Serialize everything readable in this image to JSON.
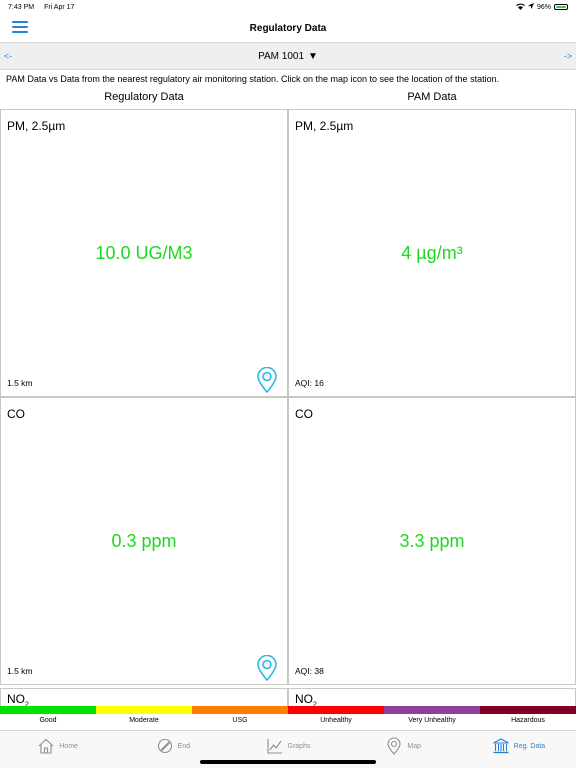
{
  "status": {
    "time": "7:43 PM",
    "date": "Fri Apr 17",
    "battery": "96%",
    "battery_level": 0.96
  },
  "nav": {
    "title": "Regulatory Data"
  },
  "device": {
    "prev": "<-",
    "next": "->",
    "name": "PAM 1001",
    "caret": "▼"
  },
  "description": "PAM Data vs Data from the nearest regulatory air monitoring station. Click on the map icon to see the location of the station.",
  "columns": {
    "left": "Regulatory Data",
    "right": "PAM Data"
  },
  "rows": [
    {
      "regulatory": {
        "title": "PM, 2.5µm",
        "value": "10.0 UG/M3",
        "foot": "1.5 km"
      },
      "pam": {
        "title": "PM, 2.5µm",
        "value": "4 µg/m³",
        "foot": "AQI: 16"
      }
    },
    {
      "regulatory": {
        "title": "CO",
        "value": "0.3 ppm",
        "foot": "1.5 km"
      },
      "pam": {
        "title": "CO",
        "value": "3.3 ppm",
        "foot": "AQI: 38"
      }
    },
    {
      "regulatory": {
        "title": "NO",
        "title_sub": "2"
      },
      "pam": {
        "title": "NO",
        "title_sub": "2"
      }
    }
  ],
  "aqi_scale": [
    {
      "label": "Good",
      "color": "#00e400"
    },
    {
      "label": "Moderate",
      "color": "#ffff00"
    },
    {
      "label": "USG",
      "color": "#ff7e00"
    },
    {
      "label": "Unhealthy",
      "color": "#ff0000"
    },
    {
      "label": "Very Unhealthy",
      "color": "#8f3f97"
    },
    {
      "label": "Hazardous",
      "color": "#7e0023"
    }
  ],
  "tabs": [
    {
      "label": "Home",
      "icon": "home-icon"
    },
    {
      "label": "End",
      "icon": "end-icon"
    },
    {
      "label": "Graphs",
      "icon": "graphs-icon"
    },
    {
      "label": "Map",
      "icon": "map-icon"
    },
    {
      "label": "Reg. Data",
      "icon": "bank-icon",
      "active": true
    }
  ],
  "colors": {
    "accent": "#2a7fd4",
    "value_green": "#1ed81e"
  }
}
